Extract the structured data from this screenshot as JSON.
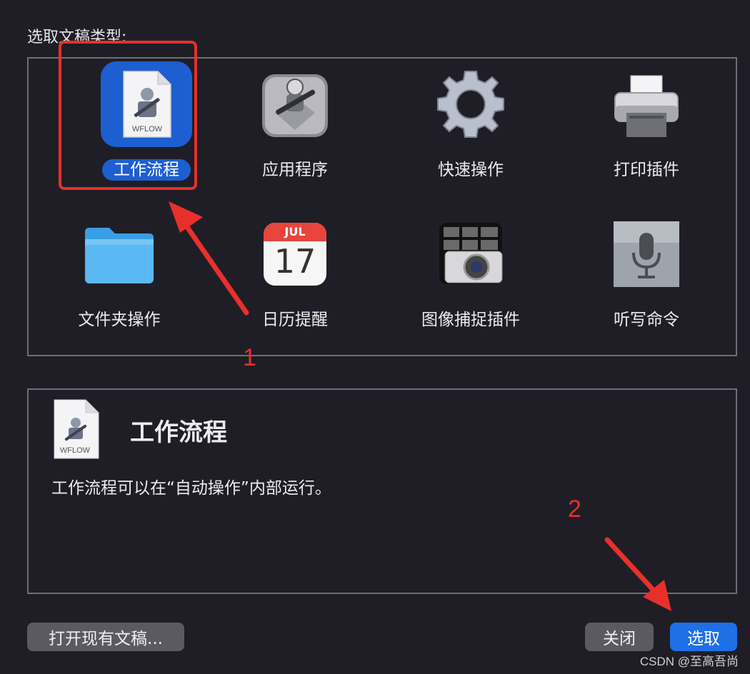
{
  "dialog": {
    "section_label": "选取文稿类型:",
    "doc_types": [
      {
        "label": "工作流程",
        "icon": "workflow-document-icon",
        "badge": "WFLOW",
        "selected": true
      },
      {
        "label": "应用程序",
        "icon": "automator-robot-icon",
        "selected": false
      },
      {
        "label": "快速操作",
        "icon": "gear-icon",
        "selected": false
      },
      {
        "label": "打印插件",
        "icon": "printer-icon",
        "selected": false
      },
      {
        "label": "文件夹操作",
        "icon": "folder-icon",
        "selected": false
      },
      {
        "label": "日历提醒",
        "icon": "calendar-icon",
        "calendar_month": "JUL",
        "calendar_day": "17",
        "selected": false
      },
      {
        "label": "图像捕捉插件",
        "icon": "camera-icon",
        "selected": false
      },
      {
        "label": "听写命令",
        "icon": "microphone-icon",
        "selected": false
      }
    ],
    "description": {
      "icon": "workflow-document-icon",
      "badge": "WFLOW",
      "title": "工作流程",
      "text": "工作流程可以在“自动操作”内部运行。"
    },
    "buttons": {
      "open_existing": "打开现有文稿...",
      "close": "关闭",
      "choose": "选取"
    }
  },
  "annotations": {
    "marker_1": "1",
    "marker_2": "2",
    "color": "#e8302b"
  },
  "watermark": "CSDN @至高吾尚",
  "colors": {
    "background": "#1f1e26",
    "accent": "#1f6fe6",
    "selection": "#1d5fd0"
  }
}
